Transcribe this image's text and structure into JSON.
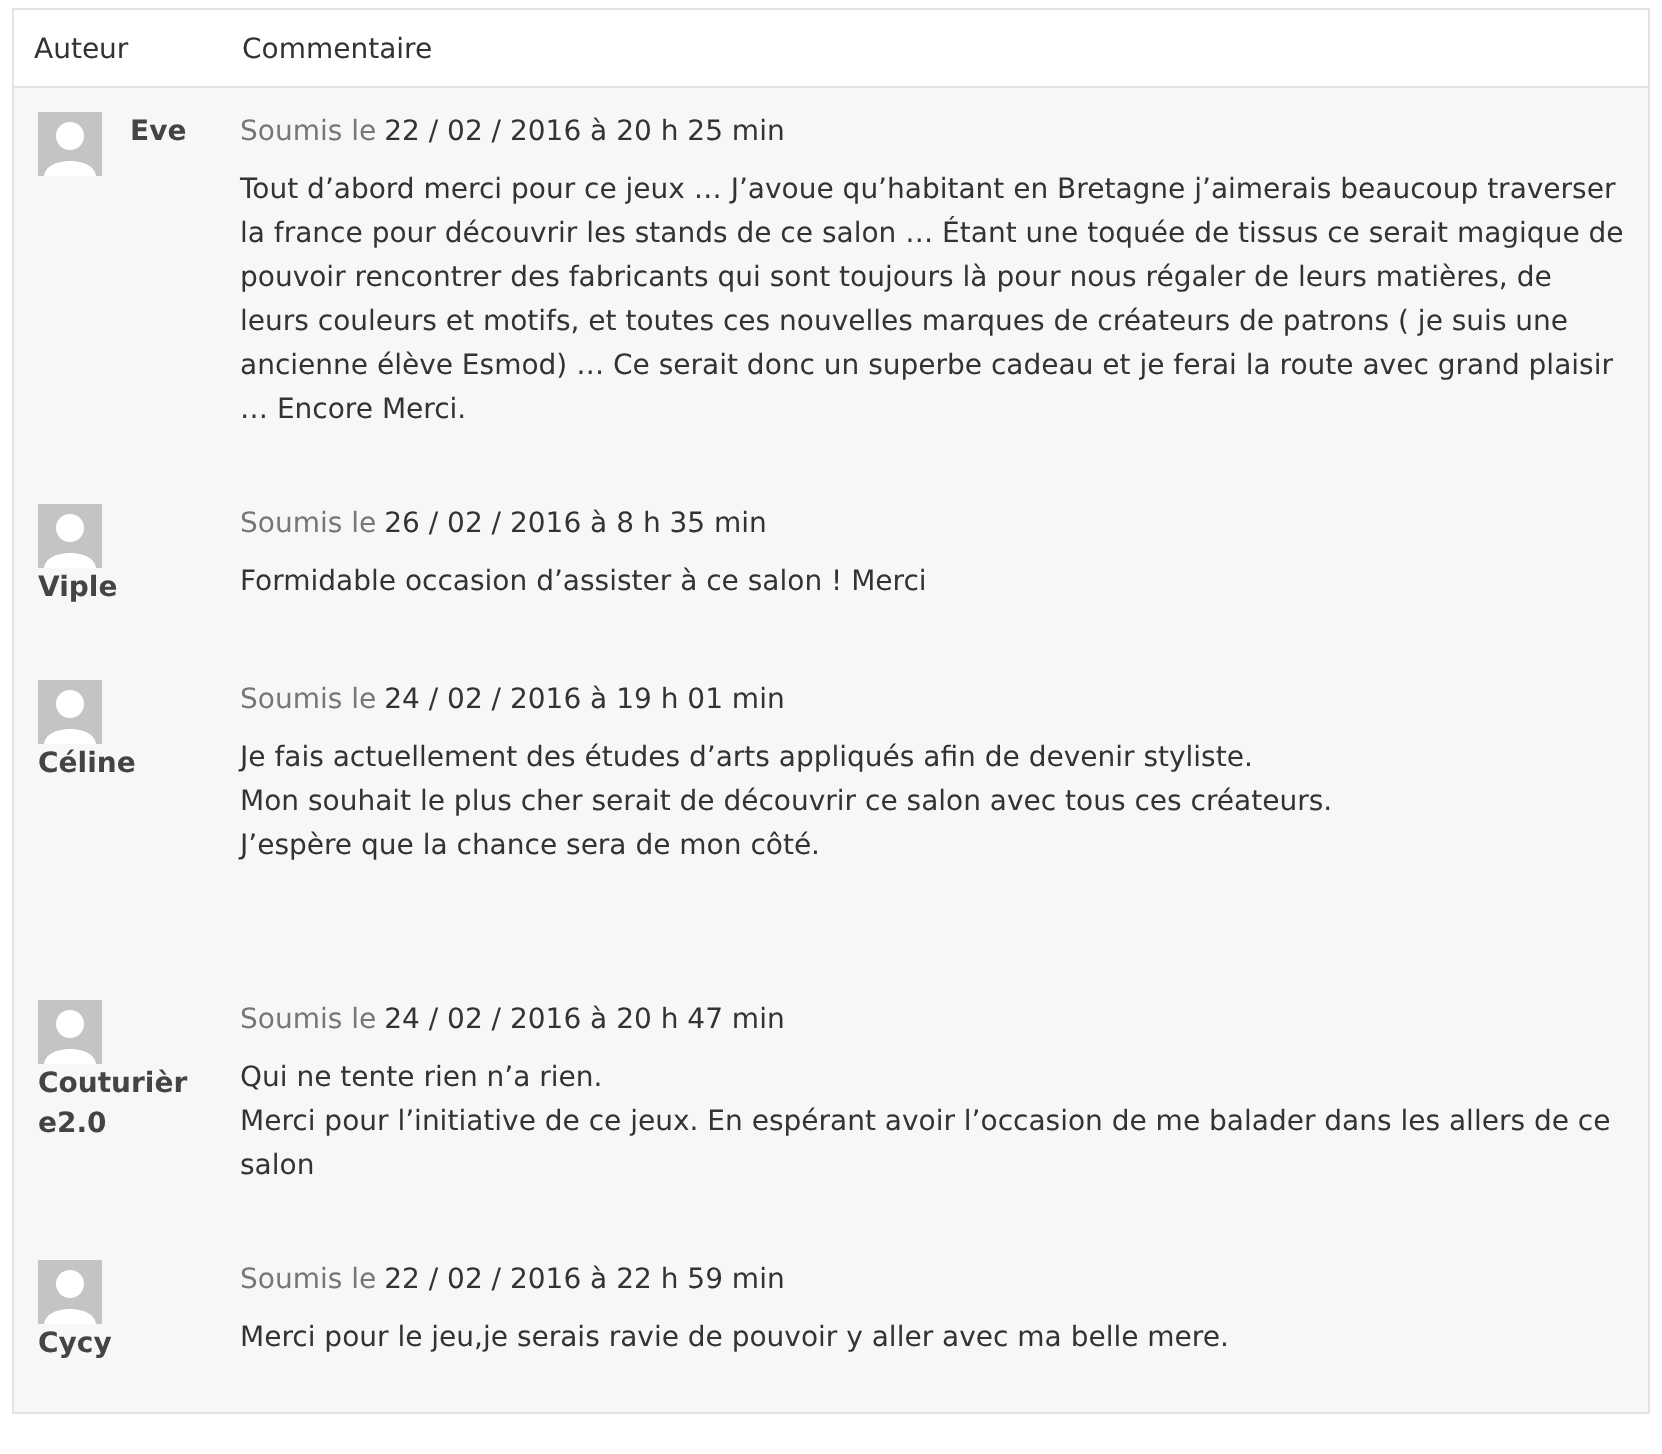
{
  "table": {
    "columns": [
      "Auteur",
      "Commentaire"
    ],
    "rows": [
      {
        "author": "Eve",
        "submitted_label": "Soumis le",
        "date": "22 / 02 / 2016 à 20 h 25 min",
        "lines": [
          "Tout d’abord merci pour ce jeux … J’avoue qu’habitant en Bretagne j’aimerais beaucoup traverser la france pour découvrir les stands de ce salon … Étant une toquée de tissus ce serait magique de pouvoir rencontrer des fabricants qui sont toujours là pour nous régaler de leurs matières, de leurs couleurs et motifs, et toutes ces nouvelles marques de créateurs de patrons ( je suis une ancienne élève Esmod) … Ce serait donc un superbe cadeau et je ferai la route avec grand plaisir … Encore Merci."
        ]
      },
      {
        "author": "Viple",
        "submitted_label": "Soumis le",
        "date": "26 / 02 / 2016 à 8 h 35 min",
        "lines": [
          "Formidable occasion d’assister à ce salon ! Merci"
        ]
      },
      {
        "author": "Céline",
        "submitted_label": "Soumis le",
        "date": "24 / 02 / 2016 à 19 h 01 min",
        "lines": [
          "Je fais actuellement des études d’arts appliqués afin de devenir styliste.",
          "Mon souhait le plus cher serait de découvrir ce salon avec tous ces créateurs.",
          "J’espère que la chance sera de mon côté."
        ]
      },
      {
        "author": "Couturière2.0",
        "submitted_label": "Soumis le",
        "date": "24 / 02 / 2016 à 20 h 47 min",
        "lines": [
          "Qui ne tente rien n’a rien.",
          "Merci pour l’initiative de ce jeux. En espérant avoir l’occasion de me balader dans les allers de ce salon"
        ]
      },
      {
        "author": "Cycy",
        "submitted_label": "Soumis le",
        "date": "22 / 02 / 2016 à 22 h 59 min",
        "lines": [
          "Merci pour le jeu,je serais ravie de pouvoir y aller avec ma belle mere."
        ]
      }
    ]
  }
}
